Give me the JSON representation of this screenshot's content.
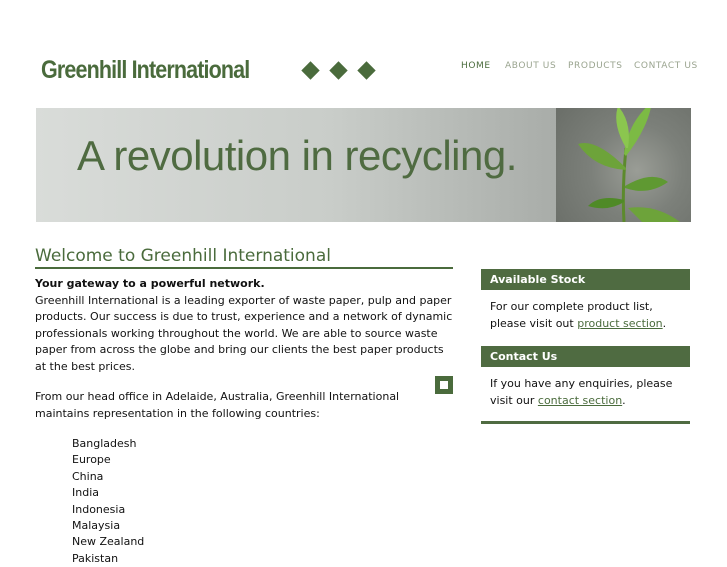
{
  "site": {
    "logo_text": "Greenhill International"
  },
  "nav": {
    "items": [
      "HOME",
      "ABOUT US",
      "PRODUCTS",
      "CONTACT US"
    ]
  },
  "banner": {
    "headline": "A revolution in recycling."
  },
  "main": {
    "heading": "Welcome to Greenhill International",
    "tagline": "Your gateway to a powerful network.",
    "intro": "Greenhill International is a leading exporter of waste paper, pulp and paper products. Our success is due to trust, experience and a network of dynamic professionals working throughout the world. We are able to source waste paper from across the globe and bring our clients the best paper products at the best prices.",
    "office_text": "From our head office in Adelaide, Australia, Greenhill International maintains representation in the following countries:",
    "countries": [
      "Bangladesh",
      "Europe",
      "China",
      "India",
      "Indonesia",
      "Malaysia",
      "New Zealand",
      "Pakistan"
    ]
  },
  "sidebar": {
    "stock": {
      "title": "Available Stock",
      "text_before": "For our complete product list, please visit out ",
      "link": "product section",
      "text_after": "."
    },
    "contact": {
      "title": "Contact Us",
      "text_before": "If you have any enquiries, please visit our ",
      "link": "contact section",
      "text_after": "."
    }
  },
  "colors": {
    "accent": "#4a6b3c",
    "nav_inactive": "#9aa48f"
  }
}
